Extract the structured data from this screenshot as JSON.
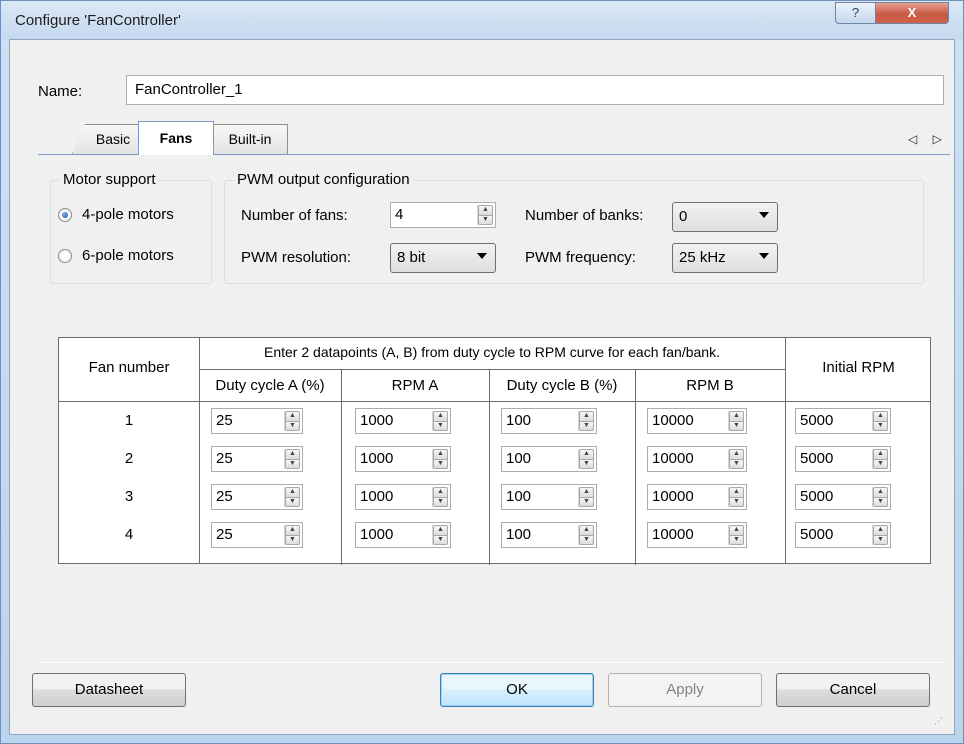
{
  "window": {
    "title": "Configure 'FanController'",
    "help_glyph": "?",
    "close_glyph": "X"
  },
  "name_row": {
    "label": "Name:",
    "value": "FanController_1"
  },
  "tabs": [
    {
      "label": "Basic",
      "active": false
    },
    {
      "label": "Fans",
      "active": true
    },
    {
      "label": "Built-in",
      "active": false
    }
  ],
  "tab_scroll_glyphs": "◁ ▷",
  "motor_support": {
    "title": "Motor support",
    "options": [
      {
        "label": "4-pole motors",
        "checked": true
      },
      {
        "label": "6-pole motors",
        "checked": false
      }
    ]
  },
  "pwm": {
    "title": "PWM output configuration",
    "num_fans_label": "Number of fans:",
    "num_fans_value": "4",
    "num_banks_label": "Number of banks:",
    "num_banks_value": "0",
    "resolution_label": "PWM resolution:",
    "resolution_value": "8 bit",
    "frequency_label": "PWM frequency:",
    "frequency_value": "25 kHz"
  },
  "fans_table": {
    "col_fan_number": "Fan number",
    "group_header": "Enter 2 datapoints (A, B) from duty cycle to RPM curve for each fan/bank.",
    "col_duty_a": "Duty cycle A (%)",
    "col_rpm_a": "RPM A",
    "col_duty_b": "Duty cycle B (%)",
    "col_rpm_b": "RPM B",
    "col_initial_rpm": "Initial RPM",
    "rows": [
      {
        "fan": "1",
        "duty_a": "25",
        "rpm_a": "1000",
        "duty_b": "100",
        "rpm_b": "10000",
        "initial_rpm": "5000"
      },
      {
        "fan": "2",
        "duty_a": "25",
        "rpm_a": "1000",
        "duty_b": "100",
        "rpm_b": "10000",
        "initial_rpm": "5000"
      },
      {
        "fan": "3",
        "duty_a": "25",
        "rpm_a": "1000",
        "duty_b": "100",
        "rpm_b": "10000",
        "initial_rpm": "5000"
      },
      {
        "fan": "4",
        "duty_a": "25",
        "rpm_a": "1000",
        "duty_b": "100",
        "rpm_b": "10000",
        "initial_rpm": "5000"
      }
    ]
  },
  "buttons": {
    "datasheet": "Datasheet",
    "ok": "OK",
    "apply": "Apply",
    "cancel": "Cancel"
  },
  "icons": {
    "spin_up": "▲",
    "spin_down": "▼",
    "resize_grip": "⋰"
  }
}
